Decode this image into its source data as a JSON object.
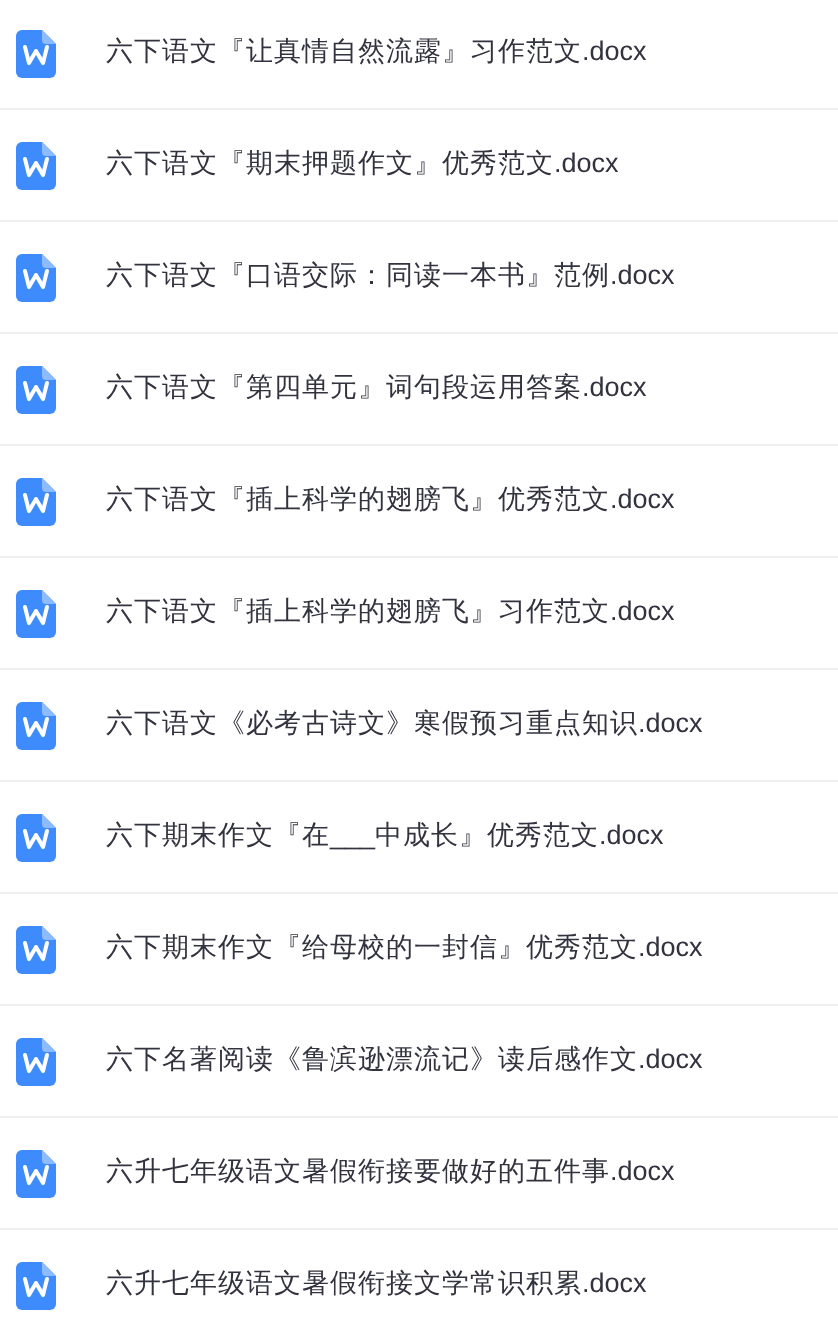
{
  "files": [
    {
      "name": "六下语文『让真情自然流露』习作范文.docx"
    },
    {
      "name": "六下语文『期末押题作文』优秀范文.docx"
    },
    {
      "name": "六下语文『口语交际：同读一本书』范例.docx"
    },
    {
      "name": "六下语文『第四单元』词句段运用答案.docx"
    },
    {
      "name": "六下语文『插上科学的翅膀飞』优秀范文.docx"
    },
    {
      "name": "六下语文『插上科学的翅膀飞』习作范文.docx"
    },
    {
      "name": "六下语文《必考古诗文》寒假预习重点知识.docx"
    },
    {
      "name": "六下期末作文『在___中成长』优秀范文.docx"
    },
    {
      "name": "六下期末作文『给母校的一封信』优秀范文.docx"
    },
    {
      "name": "六下名著阅读《鲁滨逊漂流记》读后感作文.docx"
    },
    {
      "name": "六升七年级语文暑假衔接要做好的五件事.docx"
    },
    {
      "name": "六升七年级语文暑假衔接文学常识积累.docx"
    }
  ]
}
